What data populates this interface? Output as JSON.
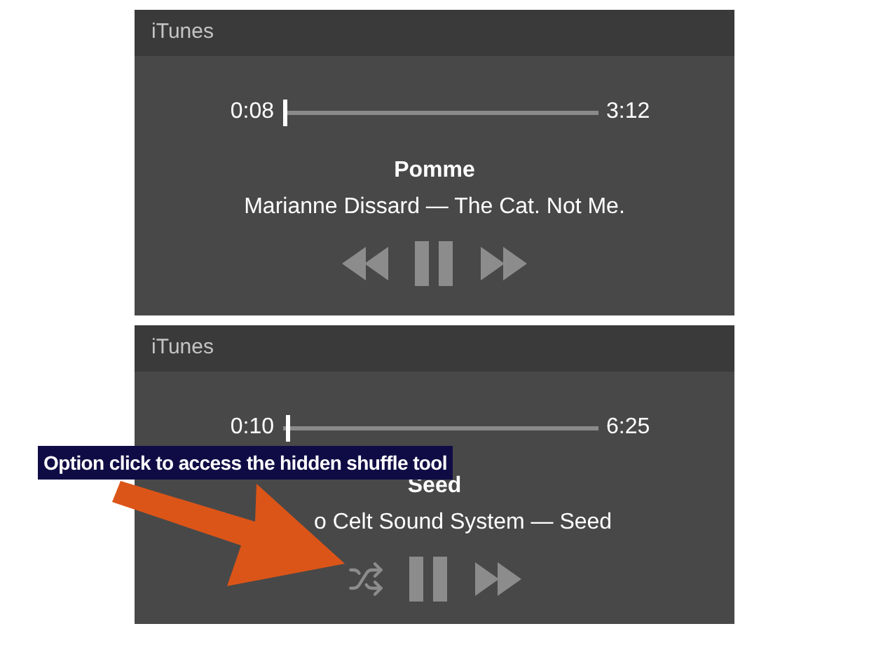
{
  "players": [
    {
      "title": "iTunes",
      "elapsed": "0:08",
      "duration": "3:12",
      "level": 0.0,
      "song": "Pomme",
      "artist": "Marianne Dissard — The Cat. Not Me.",
      "controls": [
        {
          "kind": "rewind"
        },
        {
          "kind": "pause"
        },
        {
          "kind": "forward"
        }
      ]
    },
    {
      "title": "iTunes",
      "elapsed": "0:10",
      "duration": "6:25",
      "level": 0.01,
      "song": "Seed",
      "artist": "o Celt Sound System — Seed",
      "controls": [
        {
          "kind": "shuffle"
        },
        {
          "kind": "pause"
        },
        {
          "kind": "forward"
        }
      ]
    }
  ],
  "annotation": {
    "text": "Option click to access the hidden shuffle tool"
  }
}
